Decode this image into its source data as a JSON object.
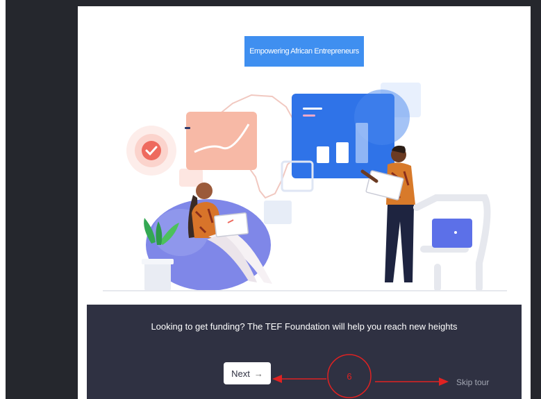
{
  "onboarding": {
    "tag_label": "Empowering African Entrepreneurs",
    "message": "Looking to get funding? The TEF Foundation will help you reach new heights",
    "next_label": "Next",
    "next_arrow": "→",
    "skip_label": "Skip tour"
  },
  "annotation": {
    "step_number": "6"
  },
  "colors": {
    "accent": "#3f8ff0",
    "footer_bg": "#2f3142",
    "annotation": "#e02222",
    "sidebar": "#25272d"
  }
}
